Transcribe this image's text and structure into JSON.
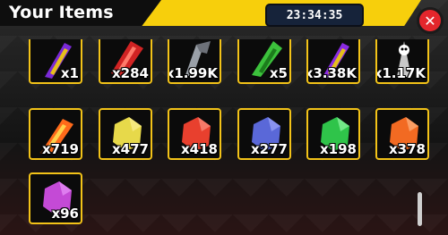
{
  "header": {
    "title": "Your Items",
    "timer": "23:34:35"
  },
  "items": [
    {
      "qty": "x1",
      "icon": "purple-sword-icon",
      "color": "#7a2ad6"
    },
    {
      "qty": "x284",
      "icon": "red-blade-icon",
      "color": "#d12323"
    },
    {
      "qty": "x1.99K",
      "icon": "steel-axe-icon",
      "color": "#9aa0a8"
    },
    {
      "qty": "x5",
      "icon": "green-blade-icon",
      "color": "#3cc23c"
    },
    {
      "qty": "x3.38K",
      "icon": "violet-sword-icon",
      "color": "#8a2be2"
    },
    {
      "qty": "x1.17K",
      "icon": "skull-blade-icon",
      "color": "#c8c8c8"
    },
    {
      "qty": "x719",
      "icon": "fire-sword-icon",
      "color": "#ff6a1a"
    },
    {
      "qty": "x477",
      "icon": "yellow-crystal-icon",
      "color": "#e7d94a"
    },
    {
      "qty": "x418",
      "icon": "red-crystal-icon",
      "color": "#e8402e"
    },
    {
      "qty": "x277",
      "icon": "blue-crystal-icon",
      "color": "#5a68d8"
    },
    {
      "qty": "x198",
      "icon": "green-crystal-icon",
      "color": "#2fc44a"
    },
    {
      "qty": "x378",
      "icon": "orange-crystal-icon",
      "color": "#f26a22"
    },
    {
      "qty": "x96",
      "icon": "purple-crystal-icon",
      "color": "#c44ad6"
    }
  ]
}
